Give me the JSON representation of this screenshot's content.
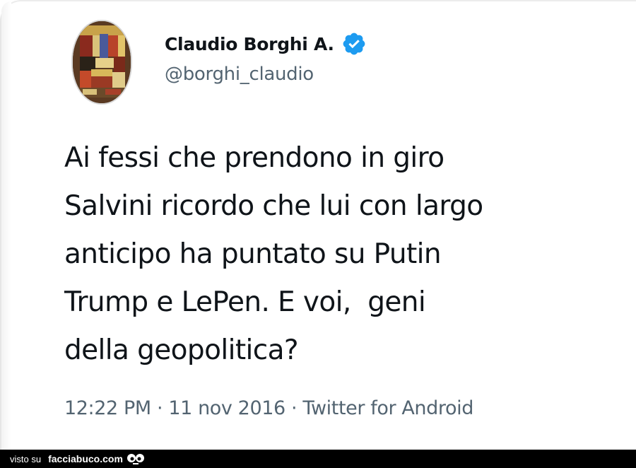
{
  "tweet": {
    "author": {
      "display_name": "Claudio Borghi A.",
      "handle": "@borghi_claudio",
      "verified": true,
      "avatar_icon": "avatar-painting"
    },
    "text_lines": [
      "Ai fessi che prendono in giro",
      "Salvini ricordo che lui con largo",
      "anticipo ha puntato su Putin",
      "Trump e LePen. E voi,  geni",
      "della geopolitica?"
    ],
    "time": "12:22 PM",
    "separator": " · ",
    "date": "11 nov 2016",
    "source": "Twitter for Android"
  },
  "footer": {
    "visto_su": "visto su",
    "site": "facciabuco.com",
    "logo_icon": "eyes-icon"
  },
  "colors": {
    "text": "#0f1419",
    "secondary": "#536471",
    "verified": "#1d9bf0",
    "footer_bg": "#000000"
  }
}
